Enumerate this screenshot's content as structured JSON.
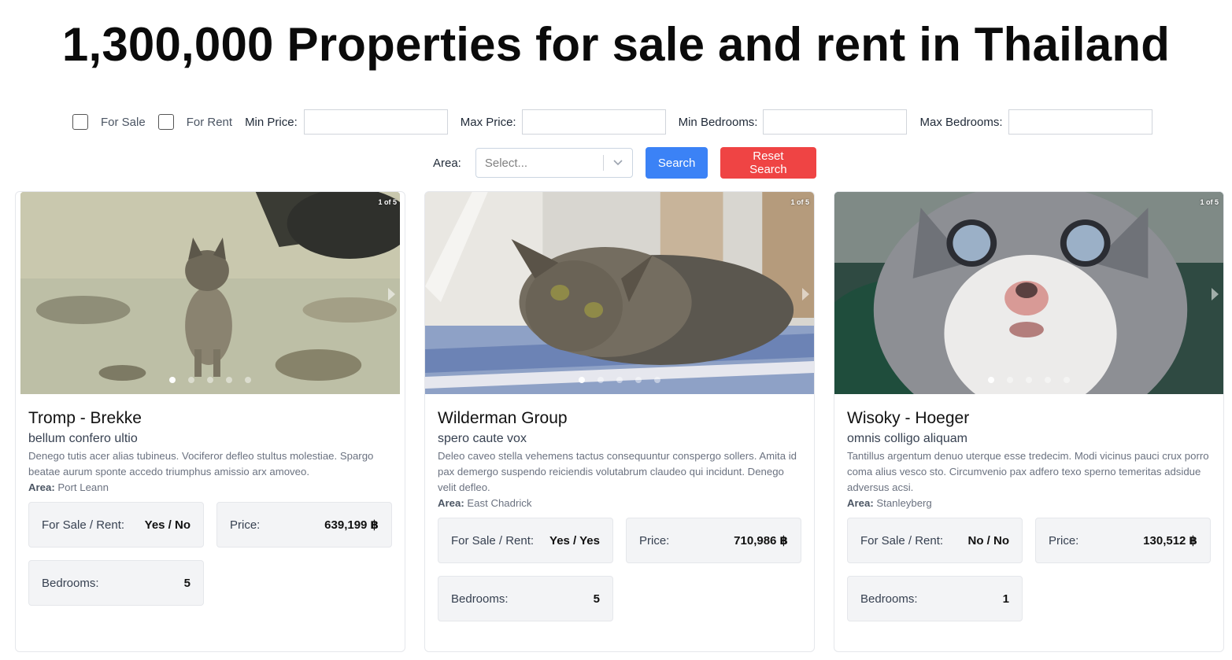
{
  "header": {
    "title": "1,300,000 Properties for sale and rent in Thailand"
  },
  "filters": {
    "for_sale_label": "For Sale",
    "for_rent_label": "For Rent",
    "min_price_label": "Min Price:",
    "max_price_label": "Max Price:",
    "min_bedrooms_label": "Min Bedrooms:",
    "max_bedrooms_label": "Max Bedrooms:",
    "area_label": "Area:",
    "area_placeholder": "Select...",
    "search_label": "Search",
    "reset_label": "Reset Search"
  },
  "colors": {
    "search_button": "#3b82f6",
    "reset_button": "#ef4444",
    "stat_background": "#f3f4f6"
  },
  "cards": [
    {
      "counter": "1 of 5",
      "image": "cat-on-beach-photo",
      "title": "Tromp - Brekke",
      "subtitle": "bellum confero ultio",
      "description": "Denego tutis acer alias tubineus. Vociferor defleo stultus molestiae. Spargo beatae aurum sponte accedo triumphus amissio arx amoveo.",
      "area_label": "Area:",
      "area": "Port Leann",
      "sale_rent_label": "For Sale / Rent:",
      "sale_rent": "Yes / No",
      "price_label": "Price:",
      "price": "639,199 ฿",
      "bedrooms_label": "Bedrooms:",
      "bedrooms": "5"
    },
    {
      "counter": "1 of 5",
      "image": "tabby-cat-lying-photo",
      "title": "Wilderman Group",
      "subtitle": "spero caute vox",
      "description": "Deleo caveo stella vehemens tactus consequuntur conspergo sollers. Amita id pax demergo suspendo reiciendis volutabrum claudeo qui incidunt. Denego velit defleo.",
      "area_label": "Area:",
      "area": "East Chadrick",
      "sale_rent_label": "For Sale / Rent:",
      "sale_rent": "Yes / Yes",
      "price_label": "Price:",
      "price": "710,986 ฿",
      "bedrooms_label": "Bedrooms:",
      "bedrooms": "5"
    },
    {
      "counter": "1 of 5",
      "image": "grey-white-kitten-photo",
      "title": "Wisoky - Hoeger",
      "subtitle": "omnis colligo aliquam",
      "description": "Tantillus argentum denuo uterque esse tredecim. Modi vicinus pauci crux porro coma alius vesco sto. Circumvenio pax adfero texo sperno temeritas adsidue adversus acsi.",
      "area_label": "Area:",
      "area": "Stanleyberg",
      "sale_rent_label": "For Sale / Rent:",
      "sale_rent": "No / No",
      "price_label": "Price:",
      "price": "130,512 ฿",
      "bedrooms_label": "Bedrooms:",
      "bedrooms": "1"
    }
  ]
}
